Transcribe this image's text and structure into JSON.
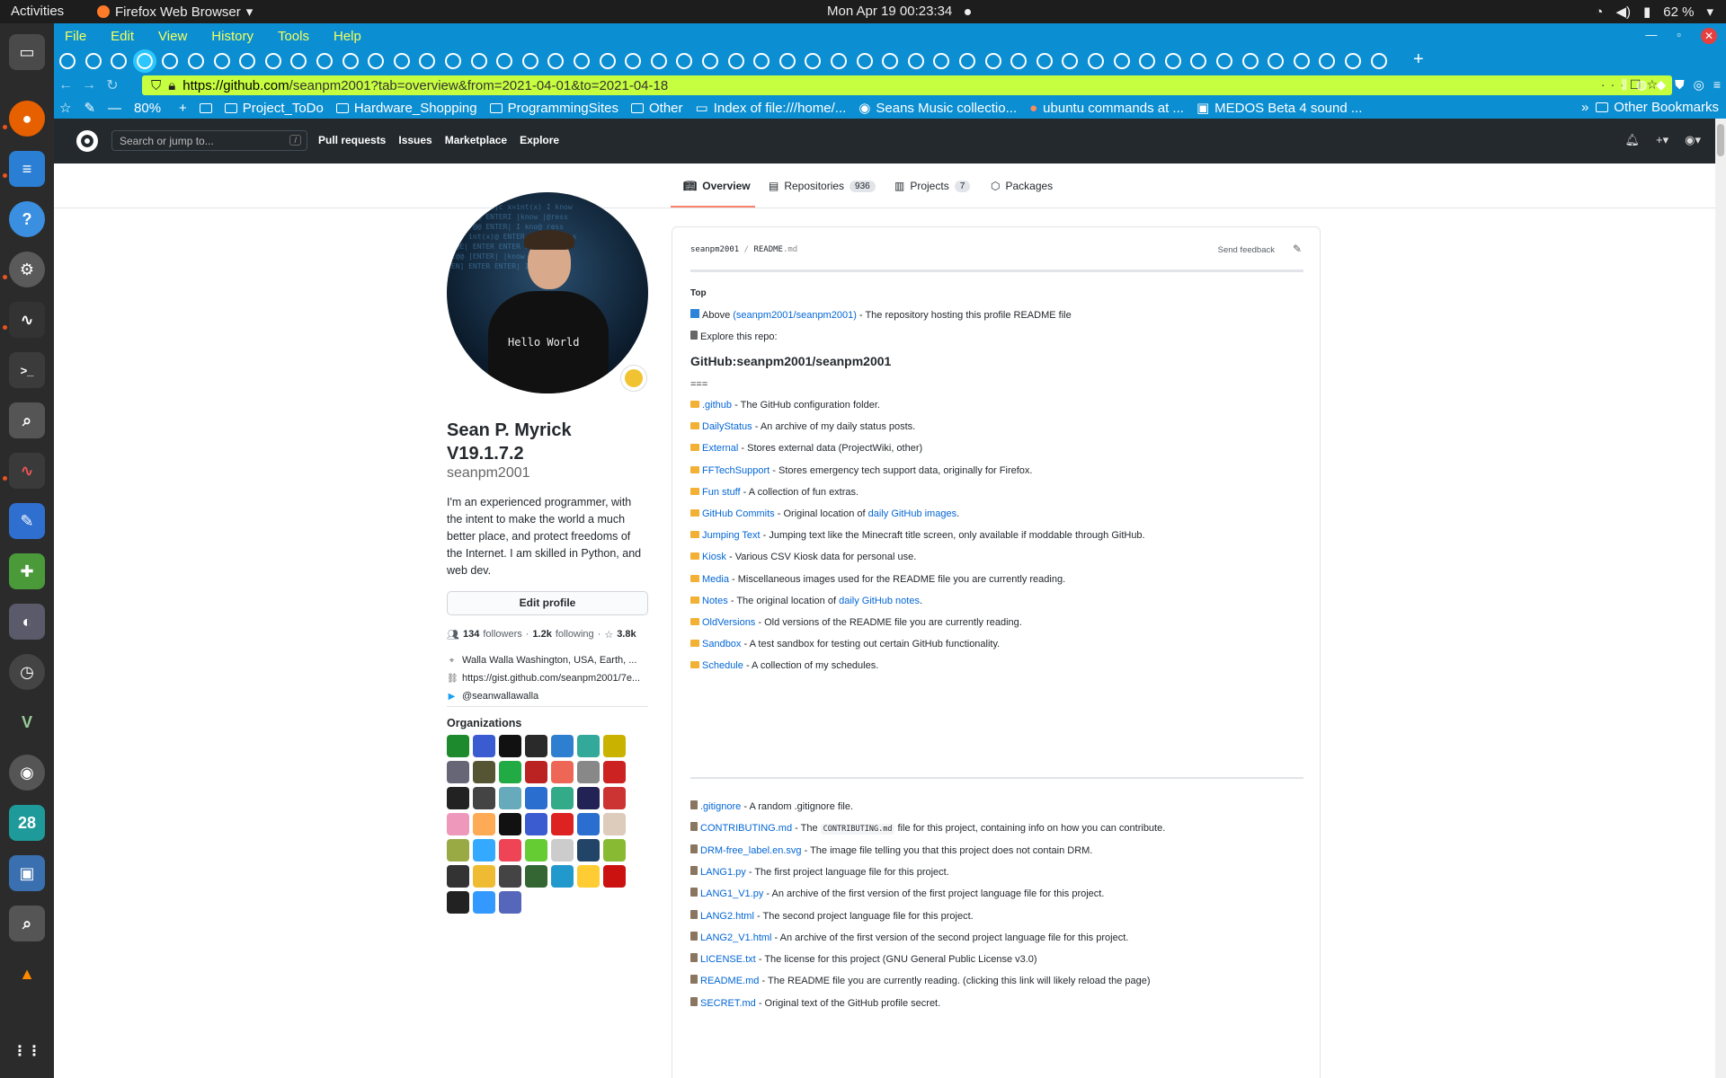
{
  "desktop": {
    "activities": "Activities",
    "app_name": "Firefox Web Browser",
    "clock": "Mon Apr 19  00:23:34",
    "battery": "62 %"
  },
  "dock": {
    "items": [
      "files-icon",
      "firefox-icon",
      "writer-icon",
      "help-icon",
      "settings-icon",
      "system-monitor-icon",
      "terminal-icon",
      "search-icon",
      "waveform-icon",
      "text-editor-icon",
      "puzzle-icon",
      "tweaks-icon",
      "clock-icon",
      "vim-icon",
      "disk-icon",
      "calendar-icon",
      "virtualbox-icon",
      "magnifier-icon",
      "vlc-icon",
      "app-grid-icon"
    ],
    "calendar_day": "28"
  },
  "browser": {
    "menu": [
      "File",
      "Edit",
      "View",
      "History",
      "Tools",
      "Help"
    ],
    "url_host": "https://github.com",
    "url_path": "/seanpm2001?tab=overview&from=2021-04-01&to=2021-04-18",
    "zoom": "80%",
    "bookmarks": [
      "Project_ToDo",
      "Hardware_Shopping",
      "ProgrammingSites",
      "Other",
      "Index of file:///home/...",
      "Seans Music collectio...",
      "ubuntu commands at ...",
      "MEDOS Beta 4 sound ..."
    ],
    "other_bookmarks": "Other Bookmarks"
  },
  "github": {
    "search_placeholder": "Search or jump to...",
    "search_key": "/",
    "nav": [
      "Pull requests",
      "Issues",
      "Marketplace",
      "Explore"
    ],
    "tabs": {
      "overview": "Overview",
      "repositories": "Repositories",
      "repositories_count": "936",
      "projects": "Projects",
      "projects_count": "7",
      "packages": "Packages"
    }
  },
  "profile": {
    "avatar_text": "Hello World",
    "name_line1": "Sean P. Myrick",
    "name_line2": "V19.1.7.2",
    "login": "seanpm2001",
    "bio": "I'm an experienced programmer, with the intent to make the world a much better place, and protect freedoms of the Internet. I am skilled in Python, and web dev.",
    "edit_label": "Edit profile",
    "followers": "134",
    "followers_label": "followers",
    "following": "1.2k",
    "following_label": "following",
    "stars": "3.8k",
    "location": "Walla Walla Washington, USA, Earth, ...",
    "website": "https://gist.github.com/seanpm2001/7e...",
    "twitter": "@seanwallawalla",
    "organizations_title": "Organizations"
  },
  "readme": {
    "owner": "seanpm2001",
    "file": "README",
    "ext": ".md",
    "feedback": "Send feedback",
    "top": "Top",
    "above_pre": "Above",
    "above_link": "(seanpm2001/seanpm2001)",
    "above_post": "- The repository hosting this profile README file",
    "explore": "Explore this repo:",
    "heading": "GitHub:seanpm2001/seanpm2001",
    "equals": "===",
    "folders": [
      {
        "name": ".github",
        "desc": "- The GitHub configuration folder."
      },
      {
        "name": "DailyStatus",
        "desc": "- An archive of my daily status posts."
      },
      {
        "name": "External",
        "desc": "- Stores external data (ProjectWiki, other)"
      },
      {
        "name": "FFTechSupport",
        "desc": "- Stores emergency tech support data, originally for Firefox."
      },
      {
        "name": "Fun stuff",
        "desc": "- A collection of fun extras."
      },
      {
        "name": "GitHub Commits",
        "desc": "- Original location of",
        "link": "daily GitHub images",
        "tail": "."
      },
      {
        "name": "Jumping Text",
        "desc": "- Jumping text like the Minecraft title screen, only available if moddable through GitHub."
      },
      {
        "name": "Kiosk",
        "desc": "- Various CSV Kiosk data for personal use."
      },
      {
        "name": "Media",
        "desc": "- Miscellaneous images used for the README file you are currently reading."
      },
      {
        "name": "Notes",
        "desc": "- The original location of",
        "link": "daily GitHub notes",
        "tail": "."
      },
      {
        "name": "OldVersions",
        "desc": "- Old versions of the README file you are currently reading."
      },
      {
        "name": "Sandbox",
        "desc": "- A test sandbox for testing out certain GitHub functionality."
      },
      {
        "name": "Schedule",
        "desc": "- A collection of my schedules."
      }
    ],
    "files": [
      {
        "name": ".gitignore",
        "desc": "- A random .gitignore file."
      },
      {
        "name": "CONTRIBUTING.md",
        "desc": "- The",
        "code": "CONTRIBUTING.md",
        "tail": "file for this project, containing info on how you can contribute."
      },
      {
        "name": "DRM-free_label.en.svg",
        "desc": "- The image file telling you that this project does not contain DRM."
      },
      {
        "name": "LANG1.py",
        "desc": "- The first project language file for this project."
      },
      {
        "name": "LANG1_V1.py",
        "desc": "- An archive of the first version of the first project language file for this project."
      },
      {
        "name": "LANG2.html",
        "desc": "- The second project language file for this project."
      },
      {
        "name": "LANG2_V1.html",
        "desc": "- An archive of the first version of the second project language file for this project."
      },
      {
        "name": "LICENSE.txt",
        "desc": "- The license for this project (GNU General Public License v3.0)"
      },
      {
        "name": "README.md",
        "desc": "- The README file you are currently reading. (clicking this link will likely reload the page)"
      },
      {
        "name": "SECRET.md",
        "desc": "- Original text of the GitHub profile secret."
      }
    ]
  }
}
